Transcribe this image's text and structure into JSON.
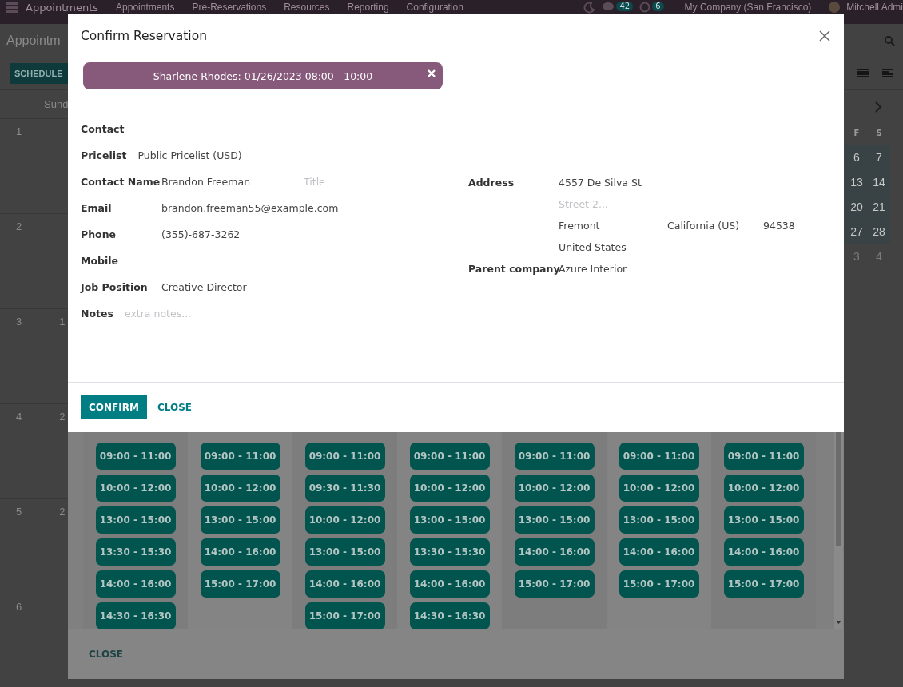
{
  "navbar": {
    "app_name": "Appointments",
    "menu": [
      "Appointments",
      "Pre-Reservations",
      "Resources",
      "Reporting",
      "Configuration"
    ],
    "message_count": "42",
    "activity_count": "6",
    "company": "My Company (San Francisco)",
    "user": "Mitchell Admi"
  },
  "control_panel": {
    "title": "Appointm",
    "schedule_button": "SCHEDULE"
  },
  "calendar": {
    "day_header": "Sund",
    "weeks": [
      {
        "number": "1"
      },
      {
        "number": "2"
      },
      {
        "number": "3",
        "day": "1"
      },
      {
        "number": "4",
        "day": "2"
      },
      {
        "number": "5",
        "day": "2"
      },
      {
        "number": "6"
      }
    ]
  },
  "mini_calendar": {
    "day_headers": [
      "F",
      "S"
    ],
    "weeks": [
      {
        "days": [
          {
            "label": "6",
            "muted": false
          },
          {
            "label": "7",
            "muted": false
          }
        ]
      },
      {
        "days": [
          {
            "label": "13",
            "muted": false
          },
          {
            "label": "14",
            "muted": false
          }
        ]
      },
      {
        "days": [
          {
            "label": "20",
            "muted": false
          },
          {
            "label": "21",
            "muted": false
          }
        ]
      },
      {
        "days": [
          {
            "label": "27",
            "muted": false
          },
          {
            "label": "28",
            "muted": false
          }
        ]
      },
      {
        "days": [
          {
            "label": "3",
            "muted": true
          },
          {
            "label": "4",
            "muted": true
          }
        ]
      }
    ]
  },
  "slot_dialog": {
    "columns": [
      {
        "slots": [
          "09:00 - 11:00",
          "10:00 - 12:00",
          "13:00 - 15:00",
          "13:30 - 15:30",
          "14:00 - 16:00",
          "14:30 - 16:30"
        ]
      },
      {
        "slots": [
          "09:00 - 11:00",
          "10:00 - 12:00",
          "13:00 - 15:00",
          "14:00 - 16:00",
          "15:00 - 17:00"
        ]
      },
      {
        "slots": [
          "09:00 - 11:00",
          "09:30 - 11:30",
          "10:00 - 12:00",
          "13:00 - 15:00",
          "14:00 - 16:00",
          "15:00 - 17:00"
        ]
      },
      {
        "slots": [
          "09:00 - 11:00",
          "10:00 - 12:00",
          "13:00 - 15:00",
          "13:30 - 15:30",
          "14:00 - 16:00",
          "14:30 - 16:30"
        ]
      },
      {
        "slots": [
          "09:00 - 11:00",
          "10:00 - 12:00",
          "13:00 - 15:00",
          "14:00 - 16:00",
          "15:00 - 17:00"
        ]
      },
      {
        "slots": [
          "09:00 - 11:00",
          "10:00 - 12:00",
          "13:00 - 15:00",
          "14:00 - 16:00",
          "15:00 - 17:00"
        ]
      },
      {
        "slots": [
          "09:00 - 11:00",
          "10:00 - 12:00",
          "13:00 - 15:00",
          "14:00 - 16:00",
          "15:00 - 17:00"
        ]
      }
    ],
    "close_button": "CLOSE"
  },
  "confirm_dialog": {
    "title": "Confirm Reservation",
    "tag": {
      "label": "Sharlene Rhodes: 01/26/2023 08:00 - 10:00",
      "color": "#875a7b"
    },
    "left_fields": [
      {
        "label": "Contact"
      },
      {
        "label": "Pricelist",
        "inline": true,
        "inputs": [
          {
            "value": "Public Pricelist (USD)"
          }
        ]
      },
      {
        "label": "Contact Name",
        "inline": false,
        "inputs": [
          {
            "value": "Brandon Freeman"
          },
          {
            "placeholder": "Title"
          }
        ]
      },
      {
        "label": "Email",
        "inline": false,
        "inputs": [
          {
            "value": "brandon.freeman55@example.com"
          }
        ]
      },
      {
        "label": "Phone",
        "inline": false,
        "inputs": [
          {
            "value": "(355)-687-3262"
          }
        ]
      },
      {
        "label": "Mobile"
      },
      {
        "label": "Job Position",
        "inline": false,
        "inputs": [
          {
            "value": "Creative Director"
          }
        ]
      },
      {
        "label": "Notes",
        "inline": true,
        "inputs": [
          {
            "placeholder": "extra notes..."
          }
        ]
      }
    ],
    "right_fields": [
      {
        "label": "Address",
        "lines": [
          {
            "inputs": [
              {
                "value": "4557 De Silva St"
              }
            ]
          },
          {
            "inputs": [
              {
                "placeholder": "Street 2..."
              }
            ]
          },
          {
            "inputs": [
              {
                "value": "Fremont"
              },
              {
                "value": "California (US)"
              },
              {
                "value": "94538"
              }
            ]
          },
          {
            "inputs": [
              {
                "value": "United States"
              }
            ]
          }
        ]
      },
      {
        "label": "Parent company",
        "lines": [
          {
            "inputs": [
              {
                "value": "Azure Interior"
              }
            ]
          }
        ]
      }
    ],
    "confirm_button": "CONFIRM",
    "close_button": "CLOSE"
  }
}
